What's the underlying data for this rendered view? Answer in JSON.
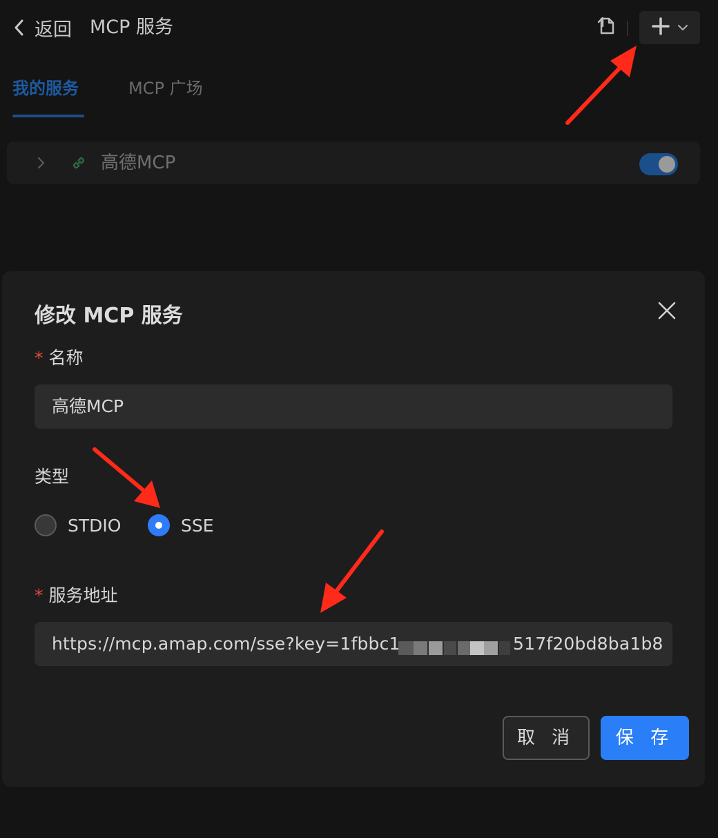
{
  "header": {
    "back_label": "返回",
    "title": "MCP 服务",
    "icons": {
      "back": "chevron-left-icon",
      "import": "document-import-icon",
      "add": "plus-icon",
      "dropdown": "chevron-down-icon"
    }
  },
  "tabs": [
    {
      "label": "我的服务",
      "active": true
    },
    {
      "label": "MCP 广场",
      "active": false
    }
  ],
  "services": [
    {
      "name": "高德MCP",
      "enabled": true,
      "icon": "link-icon"
    }
  ],
  "modal": {
    "title": "修改 MCP 服务",
    "fields": {
      "name": {
        "label": "名称",
        "required_mark": "*",
        "value": "高德MCP"
      },
      "type": {
        "label": "类型",
        "options": [
          {
            "label": "STDIO",
            "selected": false
          },
          {
            "label": "SSE",
            "selected": true
          }
        ]
      },
      "url": {
        "label": "服务地址",
        "required_mark": "*",
        "value_visible_start": "https://mcp.amap.com/sse?key=1fbbc1",
        "value_visible_end": "517f20bd8ba1b8"
      }
    },
    "buttons": {
      "cancel": "取 消",
      "save": "保 存"
    }
  },
  "colors": {
    "background": "#141414",
    "modal_bg": "#1d1d1d",
    "input_bg": "#2c2c2c",
    "primary": "#2a7ef8",
    "active_tab": "#1c5aa0",
    "required": "#e34d3b",
    "annotation_arrow": "#ff2a1a"
  }
}
